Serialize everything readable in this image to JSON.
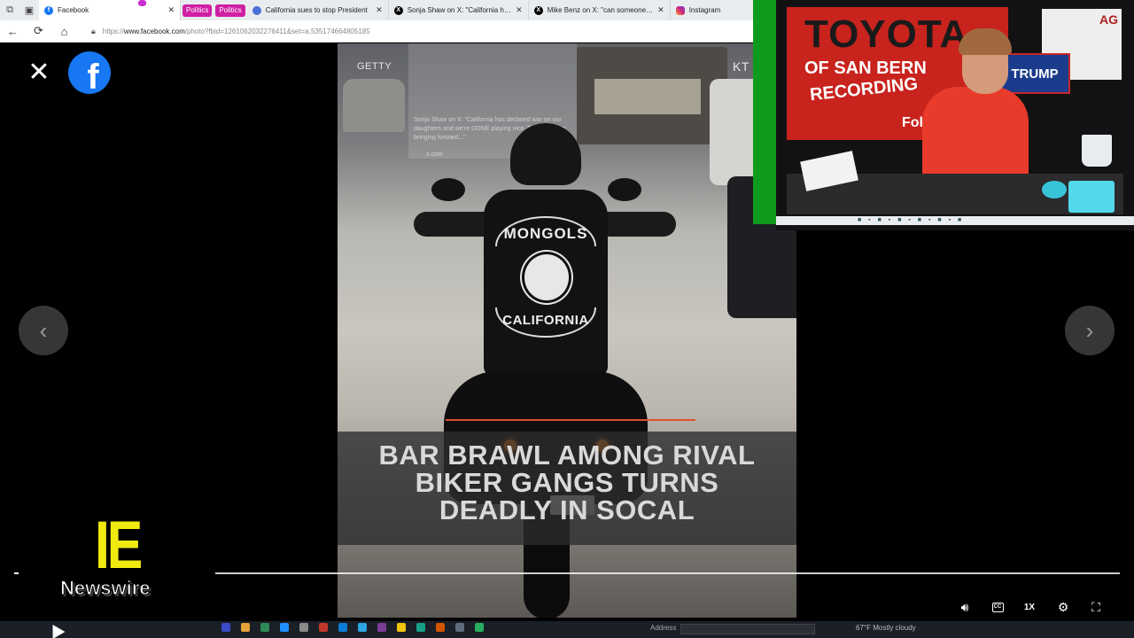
{
  "browser": {
    "tabs": [
      {
        "title": "Facebook",
        "favicon": "facebook-icon",
        "active": true
      },
      {
        "title": "California sues to stop President",
        "favicon": "news-icon",
        "active": false
      },
      {
        "title": "Sonja Shaw on X: \"California has",
        "favicon": "x-icon",
        "active": false
      },
      {
        "title": "Mike Benz on X: \"can someone te",
        "favicon": "x-icon",
        "active": false
      },
      {
        "title": "Instagram",
        "favicon": "instagram-icon",
        "active": false
      }
    ],
    "tab_groups": [
      "Politics",
      "Politics"
    ],
    "url_scheme": "https://",
    "url_host": "www.facebook.com",
    "url_path": "/photo?fbid=1261062032276411&set=a.535174664805185"
  },
  "viewer": {
    "close_glyph": "✕",
    "logo_letter": "f",
    "prev_glyph": "‹",
    "next_glyph": "›"
  },
  "photo": {
    "watermark_left": "GETTY",
    "watermark_right": "KT",
    "vest_top": "MONGOLS",
    "vest_bottom": "CALIFORNIA",
    "caption_lines": [
      "BAR BRAWL AMONG RIVAL",
      "BIKER GANGS TURNS",
      "DEADLY IN SOCAL"
    ],
    "hover_card_text": "Sonja Shaw on X: \"California has declared war on our daughters and we're DONE playing nice. Tomorrow, I'm bringing forward...\"",
    "hover_card_link": "x.com"
  },
  "webcam": {
    "sign_top": "TOYOTA",
    "sign_mid": "OF SAN BERN",
    "sign_low": "RECORDING",
    "sign_follow": "Follow",
    "trump_sign": "TRUMP",
    "flag_text": "AG"
  },
  "branding": {
    "logo_letters": "IE",
    "logo_word": "Newswire"
  },
  "player": {
    "speed": "1X",
    "cc_label": "CC"
  },
  "taskbar": {
    "address_label": "Address",
    "weather": "67°F  Mostly cloudy"
  }
}
